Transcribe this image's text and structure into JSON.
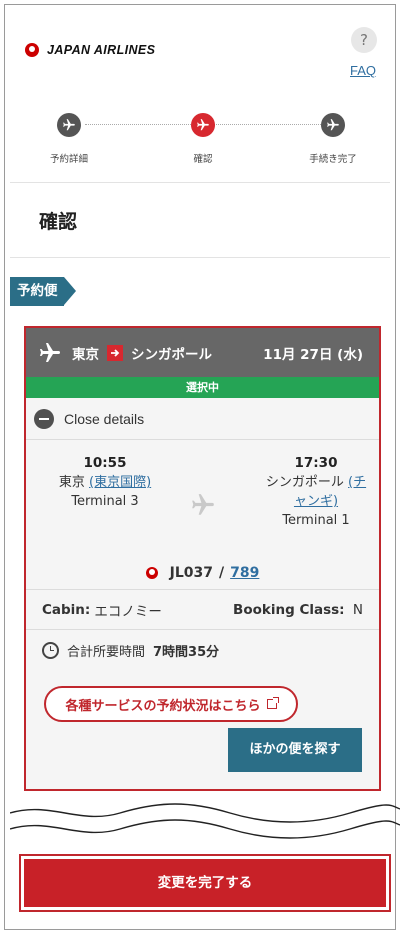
{
  "header": {
    "brand": "JAPAN AIRLINES",
    "help_glyph": "?",
    "faq_label": "FAQ"
  },
  "steps": [
    {
      "label": "予約詳細",
      "state": "done"
    },
    {
      "label": "確認",
      "state": "active"
    },
    {
      "label": "手続き完了",
      "state": "upcoming"
    }
  ],
  "page_title": "確認",
  "section_tag": "予約便",
  "flight": {
    "origin": "東京",
    "destination": "シンガポール",
    "date": "11月 27日 (水)",
    "status": "選択中",
    "close_details": "Close details",
    "departure": {
      "time": "10:55",
      "city": "東京",
      "airport": "(東京国際)",
      "terminal": "Terminal 3"
    },
    "arrival": {
      "time": "17:30",
      "city": "シンガポール",
      "airport_line1": "(チ",
      "airport_line2": "ャンギ)",
      "terminal": "Terminal 1"
    },
    "flight_number": "JL037",
    "aircraft": "789",
    "cabin_label": "Cabin:",
    "cabin_value": "エコノミー",
    "booking_class_label": "Booking Class:",
    "booking_class_value": "N",
    "duration_label": "合計所要時間",
    "duration_value": "7時間35分",
    "service_status_button": "各種サービスの予約状況はこちら",
    "other_flights_button": "ほかの便を探す"
  },
  "complete_button": "変更を完了する",
  "colors": {
    "brand_red": "#c82128",
    "teal": "#2b6e87",
    "selected_green": "#25a455",
    "link_blue": "#2f6ea0"
  }
}
